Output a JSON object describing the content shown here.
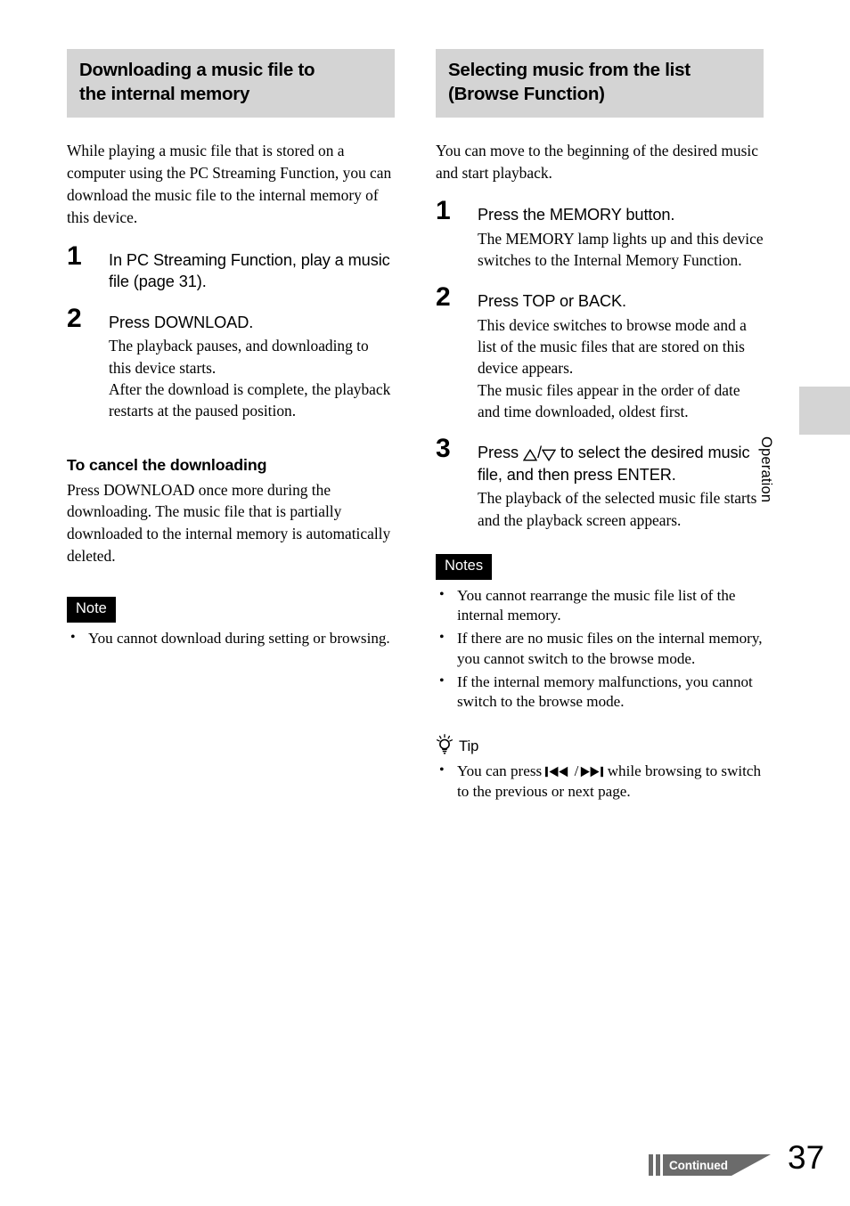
{
  "page": {
    "number": "37",
    "side_tab_label": "Operation",
    "continued_label": "Continued"
  },
  "left_column": {
    "section_title_line1": "Downloading a music file to",
    "section_title_line2": "the internal memory",
    "intro": "While playing a music file that is stored on a computer using the PC Streaming Function, you can download the music file to the internal memory of this device.",
    "steps": [
      {
        "number": "1",
        "title": "In PC Streaming Function, play a music file (page 31).",
        "body": []
      },
      {
        "number": "2",
        "title": "Press DOWNLOAD.",
        "body": [
          "The playback pauses, and downloading to this device starts.",
          "After the download is complete, the playback restarts at the paused position."
        ]
      }
    ],
    "subsection": {
      "heading": "To cancel the downloading",
      "paragraph": "Press DOWNLOAD once more during the downloading. The music file that is partially downloaded to the internal memory is automatically deleted."
    },
    "note": {
      "badge": "Note",
      "items": [
        "You cannot download during setting or browsing."
      ]
    }
  },
  "right_column": {
    "section_title_line1": "Selecting music from the list",
    "section_title_line2": "(Browse Function)",
    "intro": "You can move to the beginning of the desired music and start playback.",
    "steps": [
      {
        "number": "1",
        "title": "Press the MEMORY button.",
        "body": [
          "The MEMORY lamp lights up and this device switches to the Internal Memory Function."
        ]
      },
      {
        "number": "2",
        "title": "Press TOP or BACK.",
        "body": [
          "This device switches to browse mode and a list of the music files that are stored on this device appears.",
          "The music files appear in the order of date and time downloaded, oldest first."
        ]
      },
      {
        "number": "3",
        "title_before": "Press ",
        "title_after": " to select the desired music file, and then press ENTER.",
        "body": [
          "The playback of the selected music file starts and the playback screen appears."
        ]
      }
    ],
    "notes": {
      "badge": "Notes",
      "items": [
        "You cannot rearrange the music file list of the internal memory.",
        "If there are no music files on the internal memory, you cannot switch to the browse mode.",
        "If the internal memory malfunctions, you cannot switch to the browse mode."
      ]
    },
    "tip": {
      "badge": "Tip",
      "text_before": "You can press ",
      "text_after": " while browsing to switch to the previous or next page."
    }
  },
  "colors": {
    "header_bar": "#d4d4d4",
    "badge_bg": "#000000",
    "continued_gray": "#6b6b6b"
  }
}
